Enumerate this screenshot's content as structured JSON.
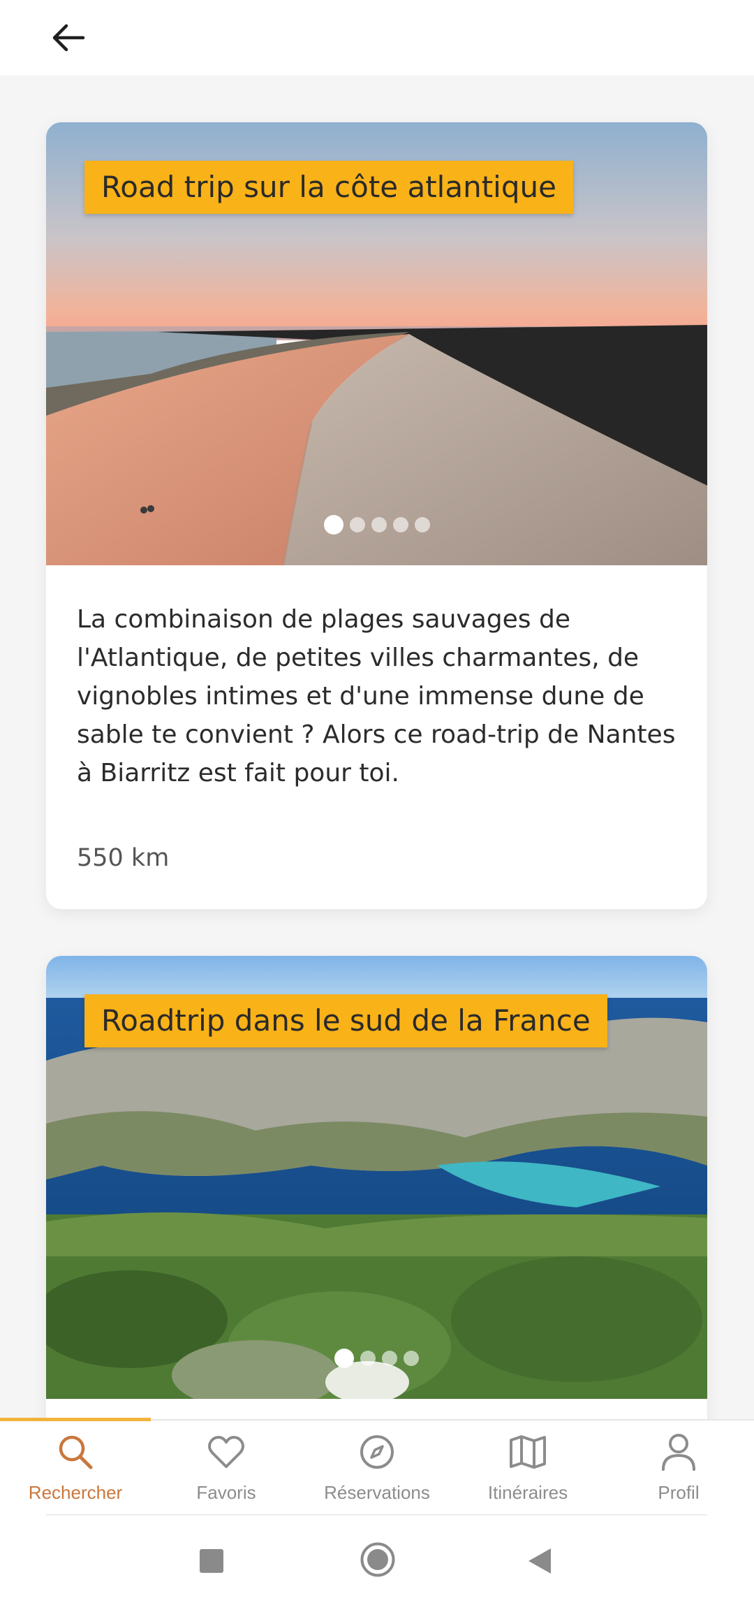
{
  "header": {
    "back_icon": "arrow-left-icon"
  },
  "cards": [
    {
      "title": "Road trip sur la côte atlantique",
      "description": "La combinaison de plages sauvages de l'Atlantique, de petites villes charmantes, de vignobles intimes et d'une immense dune de sable te convient ? Alors ce road-trip de Nantes à Biarritz est fait pour toi.",
      "distance": "550 km",
      "image": "dune-at-sunset",
      "carousel": {
        "count": 5,
        "active": 1
      }
    },
    {
      "title": "Roadtrip dans le sud de la France",
      "image": "calanque-coastline",
      "carousel": {
        "count": 4,
        "active": 1
      }
    }
  ],
  "bottom_nav": {
    "items": [
      {
        "label": "Rechercher",
        "icon": "search-icon",
        "active": true
      },
      {
        "label": "Favoris",
        "icon": "heart-icon",
        "active": false
      },
      {
        "label": "Réservations",
        "icon": "compass-icon",
        "active": false
      },
      {
        "label": "Itinéraires",
        "icon": "map-icon",
        "active": false
      },
      {
        "label": "Profil",
        "icon": "user-icon",
        "active": false
      }
    ],
    "active_color": "#c9773d",
    "inactive_color": "#8c8c8c"
  },
  "colors": {
    "badge": "#f9b218",
    "indicator": "#f2b33d"
  }
}
